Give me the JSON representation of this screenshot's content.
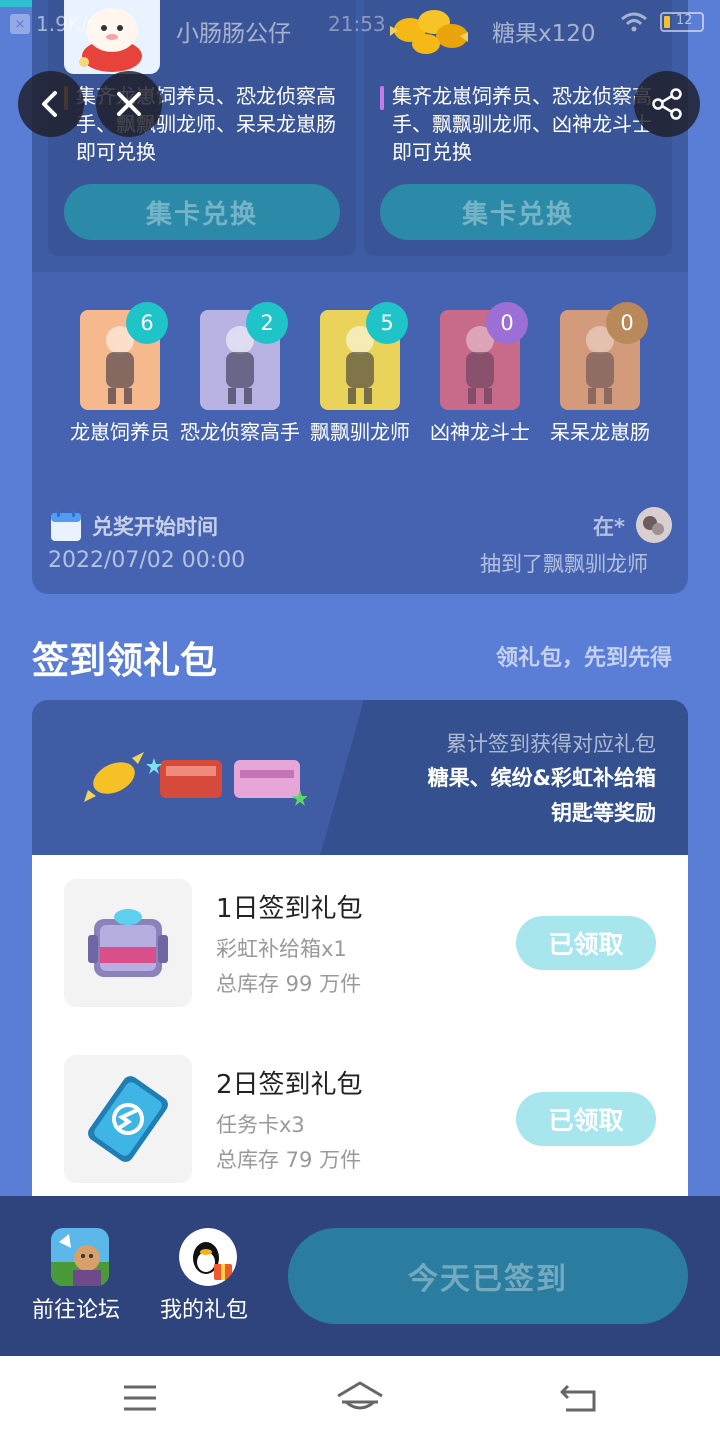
{
  "status_bar": {
    "speed": "1.9K/s",
    "time": "21:53",
    "battery": "12"
  },
  "exchange": {
    "left": {
      "item_name": "小肠肠公仔",
      "description": "集齐龙崽饲养员、恐龙侦察高手、飘飘驯龙师、呆呆龙崽肠即可兑换",
      "button": "集卡兑换"
    },
    "right": {
      "item_name": "糖果x120",
      "description": "集齐龙崽饲养员、恐龙侦察高手、飘飘驯龙师、凶神龙斗士即可兑换",
      "button": "集卡兑换"
    }
  },
  "nav": {
    "back_icon": "chevron-left-icon",
    "close_icon": "close-icon",
    "share_icon": "share-icon"
  },
  "cards": [
    {
      "label": "龙崽饲养员",
      "count": "6",
      "badge_color": "#1fc4c9",
      "bg": "#f6b88d"
    },
    {
      "label": "恐龙侦察高手",
      "count": "2",
      "badge_color": "#1fc4c9",
      "bg": "#b9b3e3"
    },
    {
      "label": "飘飘驯龙师",
      "count": "5",
      "badge_color": "#1fc4c9",
      "bg": "#e9d35a"
    },
    {
      "label": "凶神龙斗士",
      "count": "0",
      "badge_color": "#9b6fd6",
      "bg": "#c86b8a"
    },
    {
      "label": "呆呆龙崽肠",
      "count": "0",
      "badge_color": "#b9895a",
      "bg": "#d49a7c"
    }
  ],
  "redeem": {
    "title": "兑奖开始时间",
    "date": "2022/07/02 00:00",
    "winner_name": "在*",
    "winner_text": "抽到了飘飘驯龙师"
  },
  "signin": {
    "title": "签到领礼包",
    "subtitle": "领礼包，先到先得",
    "banner_line1": "累计签到获得对应礼包",
    "banner_line2": "糖果、缤纷&彩虹补给箱",
    "banner_line3": "钥匙等奖励",
    "gifts": [
      {
        "title": "1日签到礼包",
        "item": "彩虹补给箱x1",
        "stock": "总库存 99 万件",
        "button": "已领取"
      },
      {
        "title": "2日签到礼包",
        "item": "任务卡x3",
        "stock": "总库存 79 万件",
        "button": "已领取"
      }
    ]
  },
  "bottom": {
    "forum_label": "前往论坛",
    "gifts_label": "我的礼包",
    "signed_button": "今天已签到"
  },
  "colors": {
    "page_bg": "#5a7dd6",
    "panel": "#4563b0",
    "teal_button": "#2b8aa8",
    "claimed_button": "#a8e6ee",
    "bottom_bar": "#2f447d"
  }
}
